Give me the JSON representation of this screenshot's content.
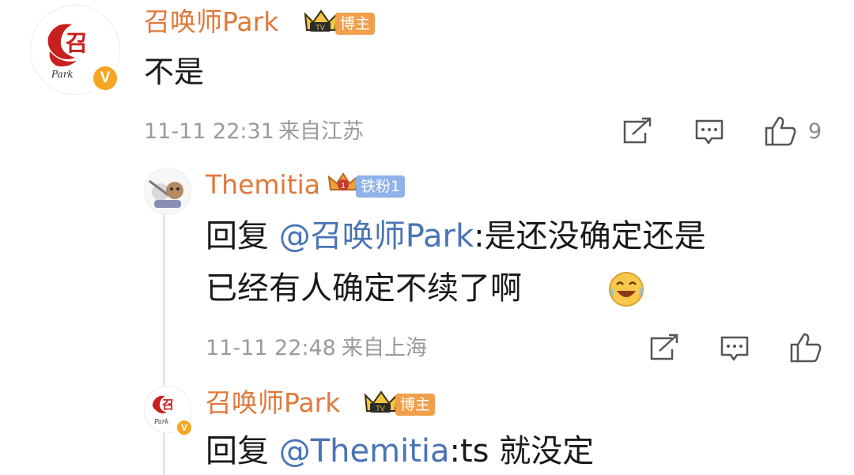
{
  "colors": {
    "username": "#e0783a",
    "mention": "#4a74b5",
    "tag_blogger": "#f0a04b",
    "tag_fan": "#8fb2ea",
    "verified": "#f5a623",
    "meta": "#9a9a9a"
  },
  "main_comment": {
    "avatar_text": "召",
    "avatar_sub": "Park",
    "username": "召唤师Park",
    "badge_icon": "crown-icon",
    "tag": "博主",
    "verified_icon": "V",
    "text": "不是",
    "time": "11-11 22:31",
    "location": "来自江苏",
    "like_count": "9"
  },
  "reply1": {
    "username": "Themitia",
    "badge_icon": "crown-icon",
    "tag": "铁粉1",
    "reply_prefix": "回复 ",
    "mention": "@召唤师Park",
    "line1_rest": ":是还没确定还是",
    "line2": "已经有人确定不续了啊",
    "emoji": "laugh-cry-emoji",
    "time": "11-11 22:48",
    "location": "来自上海"
  },
  "reply2": {
    "avatar_text": "召",
    "avatar_sub": "Park",
    "username": "召唤师Park",
    "badge_icon": "crown-icon",
    "tag": "博主",
    "verified_icon": "V",
    "reply_prefix": "回复 ",
    "mention": "@Themitia",
    "text_rest": ":ts 就没定"
  }
}
